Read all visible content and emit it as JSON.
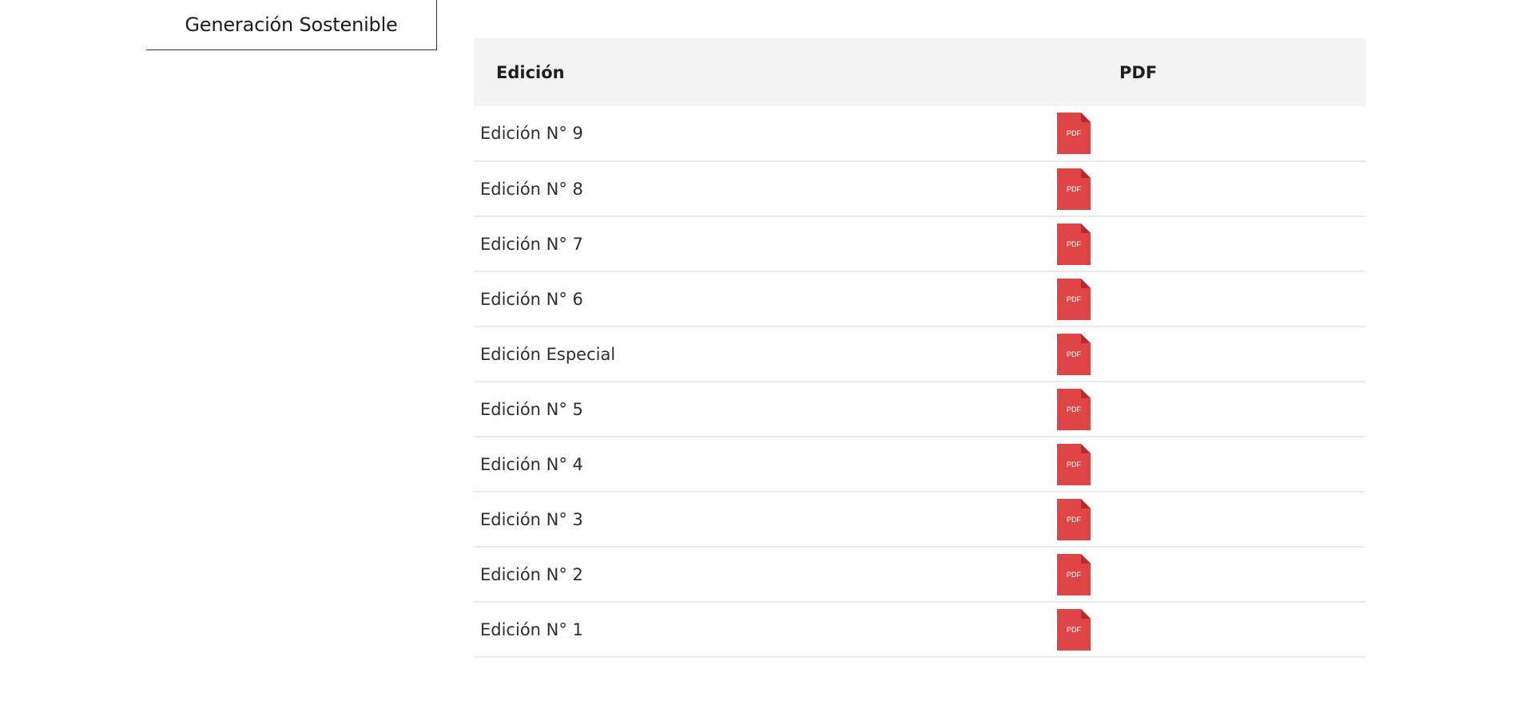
{
  "sidebar": {
    "active_tab": "Generación Sostenible"
  },
  "table": {
    "headers": {
      "edition": "Edición",
      "pdf": "PDF"
    },
    "pdf_icon_text": "PDF",
    "pdf_icon_color": "#e04545",
    "rows": [
      {
        "edition": "Edición N° 9"
      },
      {
        "edition": "Edición N° 8"
      },
      {
        "edition": "Edición N° 7"
      },
      {
        "edition": "Edición N° 6"
      },
      {
        "edition": "Edición Especial"
      },
      {
        "edition": "Edición N° 5"
      },
      {
        "edition": "Edición N° 4"
      },
      {
        "edition": "Edición N° 3"
      },
      {
        "edition": "Edición N° 2"
      },
      {
        "edition": "Edición N° 1"
      }
    ]
  }
}
